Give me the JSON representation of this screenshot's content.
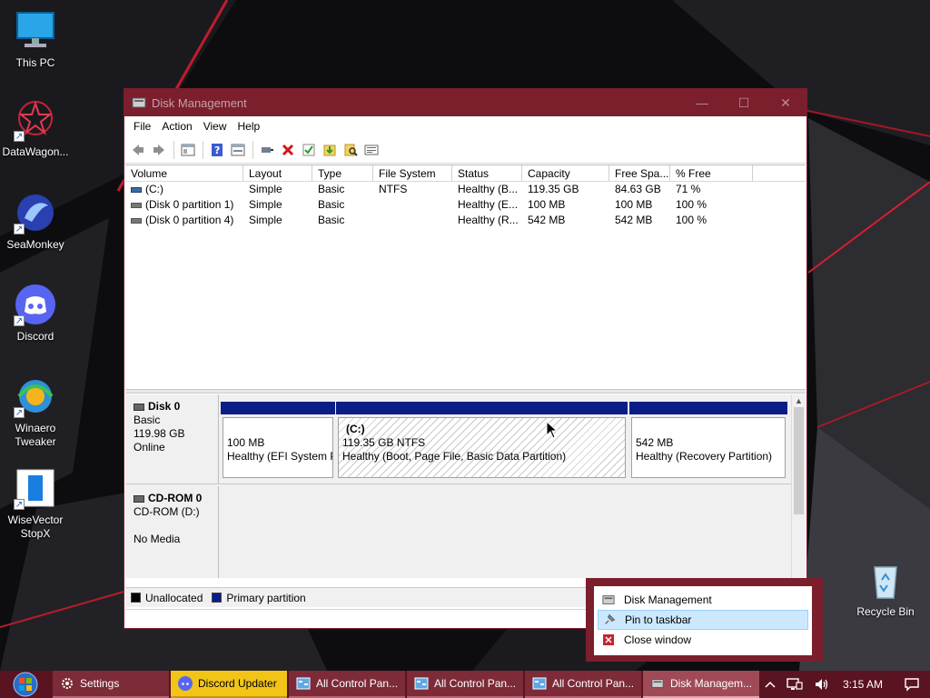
{
  "desktop": {
    "icons": [
      {
        "label": "This PC",
        "icon": "monitor-icon"
      },
      {
        "label": "DataWagon...",
        "icon": "datawagon-icon"
      },
      {
        "label": "SeaMonkey",
        "icon": "seamonkey-icon"
      },
      {
        "label": "Discord",
        "icon": "discord-icon"
      },
      {
        "label": "Winaero Tweaker",
        "icon": "winaero-icon"
      },
      {
        "label": "WiseVector StopX",
        "icon": "wisevector-icon"
      },
      {
        "label": "Recycle Bin",
        "icon": "recycle-bin-icon"
      }
    ]
  },
  "window": {
    "title": "Disk Management",
    "controls": {
      "minimize": "—",
      "maximize": "☐",
      "close": "✕"
    },
    "menu": [
      "File",
      "Action",
      "View",
      "Help"
    ],
    "toolbar_icons": [
      "back-arrow-icon",
      "forward-arrow-icon",
      "properties-icon",
      "help-icon",
      "view-icon",
      "connect-icon",
      "delete-icon",
      "check-icon",
      "import-icon",
      "search-icon",
      "list-icon"
    ]
  },
  "volume_table": {
    "columns": [
      "Volume",
      "Layout",
      "Type",
      "File System",
      "Status",
      "Capacity",
      "Free Spa...",
      "% Free",
      ""
    ],
    "rows": [
      [
        "(C:)",
        "Simple",
        "Basic",
        "NTFS",
        "Healthy (B...",
        "119.35 GB",
        "84.63 GB",
        "71 %"
      ],
      [
        "(Disk 0 partition 1)",
        "Simple",
        "Basic",
        "",
        "Healthy (E...",
        "100 MB",
        "100 MB",
        "100 %"
      ],
      [
        "(Disk 0 partition 4)",
        "Simple",
        "Basic",
        "",
        "Healthy (R...",
        "542 MB",
        "542 MB",
        "100 %"
      ]
    ]
  },
  "disks": [
    {
      "name": "Disk 0",
      "type": "Basic",
      "size": "119.98 GB",
      "state": "Online",
      "partitions": [
        {
          "label": "",
          "line1": "100 MB",
          "line2": "Healthy (EFI System P"
        },
        {
          "label": "(C:)",
          "line1": "119.35 GB NTFS",
          "line2": "Healthy (Boot, Page File, Basic Data Partition)"
        },
        {
          "label": "",
          "line1": "542 MB",
          "line2": "Healthy (Recovery Partition)"
        }
      ]
    },
    {
      "name": "CD-ROM 0",
      "type": "CD-ROM (D:)",
      "size": "",
      "state": "No Media"
    }
  ],
  "legend": [
    {
      "label": "Unallocated",
      "color": "#000000"
    },
    {
      "label": "Primary partition",
      "color": "#0a1e86"
    }
  ],
  "jumplist": {
    "items": [
      "Disk Management",
      "Pin to taskbar",
      "Close window"
    ]
  },
  "taskbar": {
    "buttons": [
      "Settings",
      "Discord Updater",
      "All Control Pan...",
      "All Control Pan...",
      "All Control Pan...",
      "Disk Managem..."
    ],
    "time": "3:15 AM"
  },
  "colors": {
    "accent": "#7b1f2d",
    "taskbar": "#5a1320",
    "primary_partition": "#0a1e86"
  }
}
